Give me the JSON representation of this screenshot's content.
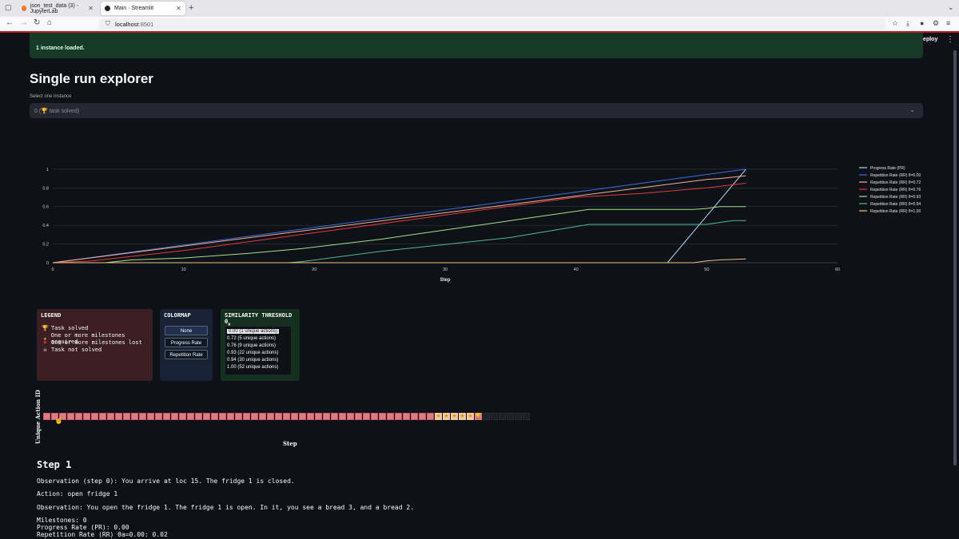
{
  "browser": {
    "tabs": [
      {
        "title": "json_test_data (3) - JupyterLab",
        "active": false,
        "icon": "jupyter-icon"
      },
      {
        "title": "Main · Streamlit",
        "active": true,
        "icon": "streamlit-icon"
      }
    ],
    "url_host": "localhost",
    "url_port": ":8501"
  },
  "header": {
    "deploy_label": "Deploy",
    "menu_icon": "kebab-icon"
  },
  "banner": {
    "text": "1 instance loaded."
  },
  "explorer": {
    "title": "Single run explorer",
    "select_label": "Select one instance",
    "selected_value": "0 (🏆 task solved)"
  },
  "chart_data": {
    "type": "line",
    "xlabel": "Step",
    "ylabel": "",
    "xlim": [
      0,
      60
    ],
    "ylim": [
      0,
      1.05
    ],
    "x_ticks": [
      "0",
      "10",
      "20",
      "30",
      "40",
      "50",
      "60"
    ],
    "y_ticks": [
      "0",
      "0.2",
      "0.4",
      "0.6",
      "0.8",
      "1"
    ],
    "legend_position": "right",
    "series": [
      {
        "name": "Progress Rate (PR)",
        "color": "#b8dcf2",
        "points": [
          [
            0,
            0
          ],
          [
            47,
            0
          ],
          [
            53,
            1
          ]
        ]
      },
      {
        "name": "Repetition Rate (RR) θ=0.00",
        "color": "#3f6fd6",
        "points": [
          [
            0,
            0
          ],
          [
            53,
            1
          ]
        ]
      },
      {
        "name": "Repetition Rate (RR) θ=0.72",
        "color": "#f4b29a",
        "points": [
          [
            0,
            0
          ],
          [
            50,
            0.89
          ],
          [
            51,
            0.9
          ],
          [
            53,
            0.93
          ]
        ]
      },
      {
        "name": "Repetition Rate (RR) θ=0.76",
        "color": "#e23b3b",
        "points": [
          [
            0,
            0
          ],
          [
            3,
            0.02
          ],
          [
            10,
            0.13
          ],
          [
            20,
            0.32
          ],
          [
            30,
            0.51
          ],
          [
            40,
            0.7
          ],
          [
            45,
            0.74
          ],
          [
            50,
            0.8
          ],
          [
            53,
            0.85
          ]
        ]
      },
      {
        "name": "Repetition Rate (RR) θ=0.93",
        "color": "#a8e08a",
        "points": [
          [
            0,
            0
          ],
          [
            4,
            0
          ],
          [
            6,
            0.03
          ],
          [
            10,
            0.05
          ],
          [
            15,
            0.1
          ],
          [
            19,
            0.15
          ],
          [
            25,
            0.25
          ],
          [
            30,
            0.35
          ],
          [
            35,
            0.45
          ],
          [
            41,
            0.57
          ],
          [
            49,
            0.57
          ],
          [
            50,
            0.58
          ],
          [
            51,
            0.6
          ],
          [
            53,
            0.6
          ]
        ]
      },
      {
        "name": "Repetition Rate (RR) θ=0.94",
        "color": "#4bbd96",
        "points": [
          [
            0,
            0
          ],
          [
            18,
            0
          ],
          [
            19,
            0.01
          ],
          [
            25,
            0.12
          ],
          [
            35,
            0.27
          ],
          [
            41,
            0.41
          ],
          [
            50,
            0.41
          ],
          [
            51,
            0.43
          ],
          [
            52,
            0.45
          ],
          [
            53,
            0.45
          ]
        ]
      },
      {
        "name": "Repetition Rate (RR) θ=1.00",
        "color": "#f4c27a",
        "points": [
          [
            0,
            0
          ],
          [
            49,
            0
          ],
          [
            50,
            0.02
          ],
          [
            51,
            0.03
          ],
          [
            53,
            0.04
          ]
        ]
      }
    ]
  },
  "legend_panel": {
    "title": "LEGEND",
    "items": [
      {
        "icon": "trophy-icon",
        "glyph": "🏆",
        "label": "Task solved"
      },
      {
        "icon": "star-icon",
        "glyph": "★",
        "label": "One or more milestones acquired"
      },
      {
        "icon": "cross-icon",
        "glyph": "✖",
        "label": "One or more milestones lost"
      },
      {
        "icon": "skull-icon",
        "glyph": "☠",
        "label": "Task not solved"
      }
    ]
  },
  "colormap_panel": {
    "title": "COLORMAP",
    "options": [
      "None",
      "Progress Rate",
      "Repetition Rate"
    ],
    "selected": "None"
  },
  "similarity_panel": {
    "title": "SIMILARITY THRESHOLD θ",
    "title_sub": "a",
    "options": [
      "0.00 (1 unique actions)",
      "0.72 (5 unique actions)",
      "0.76 (9 unique actions)",
      "0.93 (22 unique actions)",
      "0.94 (30 unique actions)",
      "1.00 (52 unique actions)"
    ],
    "selected": "0.00 (1 unique actions)"
  },
  "action_strip": {
    "ylabel": "Unique Action ID",
    "xlabel": "Step",
    "cells": {
      "pink_before_stars": 49,
      "stars": 5,
      "trophies": 1,
      "empty": 6
    }
  },
  "step_detail": {
    "title": "Step 1",
    "observation0": "Observation (step 0): You arrive at loc 15. The fridge 1 is closed.",
    "action": "Action: open fridge 1",
    "observation": "Observation: You open the fridge 1. The fridge 1 is open. In it, you see a bread 3, and a bread 2.",
    "milestones": "Milestones: 0",
    "progress_rate": "Progress Rate (PR): 0.00",
    "repetition_rate": "Repetition Rate (RR) θa=0.00: 0.02"
  }
}
